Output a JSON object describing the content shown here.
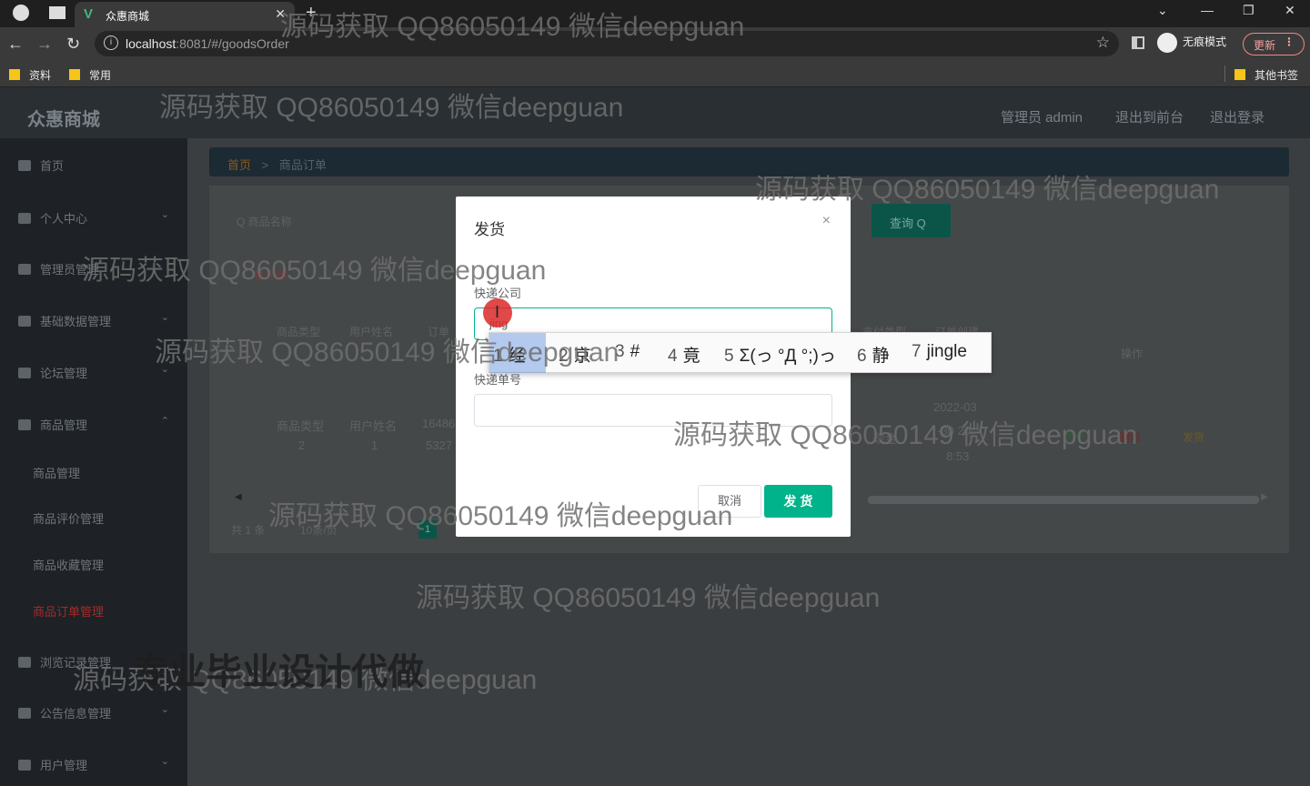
{
  "browser": {
    "tab_title": "众惠商城",
    "url_host": "localhost",
    "url_rest": ":8081/#/goodsOrder",
    "incognito_label": "无痕模式",
    "update_label": "更新",
    "bookmarks": [
      "资料",
      "常用"
    ],
    "other_bookmarks": "其他书签"
  },
  "header": {
    "logo": "众惠商城",
    "admin": "管理员 admin",
    "back_to_front": "退出到前台",
    "logout": "退出登录"
  },
  "sidebar": {
    "items": [
      {
        "label": "首页",
        "chevron": ""
      },
      {
        "label": "个人中心",
        "chevron": "⌄"
      },
      {
        "label": "管理员管理",
        "chevron": ""
      },
      {
        "label": "基础数据管理",
        "chevron": "⌄"
      },
      {
        "label": "论坛管理",
        "chevron": "⌄"
      },
      {
        "label": "商品管理",
        "chevron": "⌃"
      },
      {
        "label": "浏览记录管理",
        "chevron": ""
      },
      {
        "label": "公告信息管理",
        "chevron": "⌄"
      },
      {
        "label": "用户管理",
        "chevron": "⌄"
      }
    ],
    "subitems": [
      "商品管理",
      "商品评价管理",
      "商品收藏管理",
      "商品订单管理"
    ]
  },
  "breadcrumb": {
    "home": "首页",
    "sep": ">",
    "current": "商品订单"
  },
  "toolbar": {
    "search_placeholder": "商品名称",
    "query_label": "查询 Q",
    "delete_label": "删除"
  },
  "table": {
    "headers": [
      "商品类型",
      "用户姓名",
      "订单",
      "支付类型",
      "订单创建",
      "操作"
    ],
    "row": {
      "type_label": "商品类型",
      "type_value": "2",
      "user_label": "用户姓名",
      "user_value": "1",
      "order_a": "16486",
      "order_b": "5327",
      "pay": "现金",
      "date_a": "2022-03",
      "date_b": "-30 20:",
      "date_c": "8:53",
      "action1": "详情",
      "action2": "删除",
      "action3": "发货"
    }
  },
  "pagination": {
    "total": "共 1 条",
    "size": "10条/页",
    "page": "1"
  },
  "modal": {
    "title": "发货",
    "close": "×",
    "company_label": "快递公司",
    "company_value": "jing",
    "number_label": "快递单号",
    "number_value": "",
    "cancel_label": "取消",
    "submit_label": "发 货"
  },
  "ime": {
    "candidates": [
      {
        "n": "1",
        "t": "经"
      },
      {
        "n": "2",
        "t": "京"
      },
      {
        "n": "3",
        "t": "#"
      },
      {
        "n": "4",
        "t": "竟"
      },
      {
        "n": "5",
        "t": "Σ(っ °Д °;)っ"
      },
      {
        "n": "6",
        "t": "静"
      },
      {
        "n": "7",
        "t": "jingle"
      }
    ]
  },
  "watermarks": {
    "text": "源码获取 QQ86050149 微信deepguan",
    "banner": "专业毕业设计代做"
  }
}
